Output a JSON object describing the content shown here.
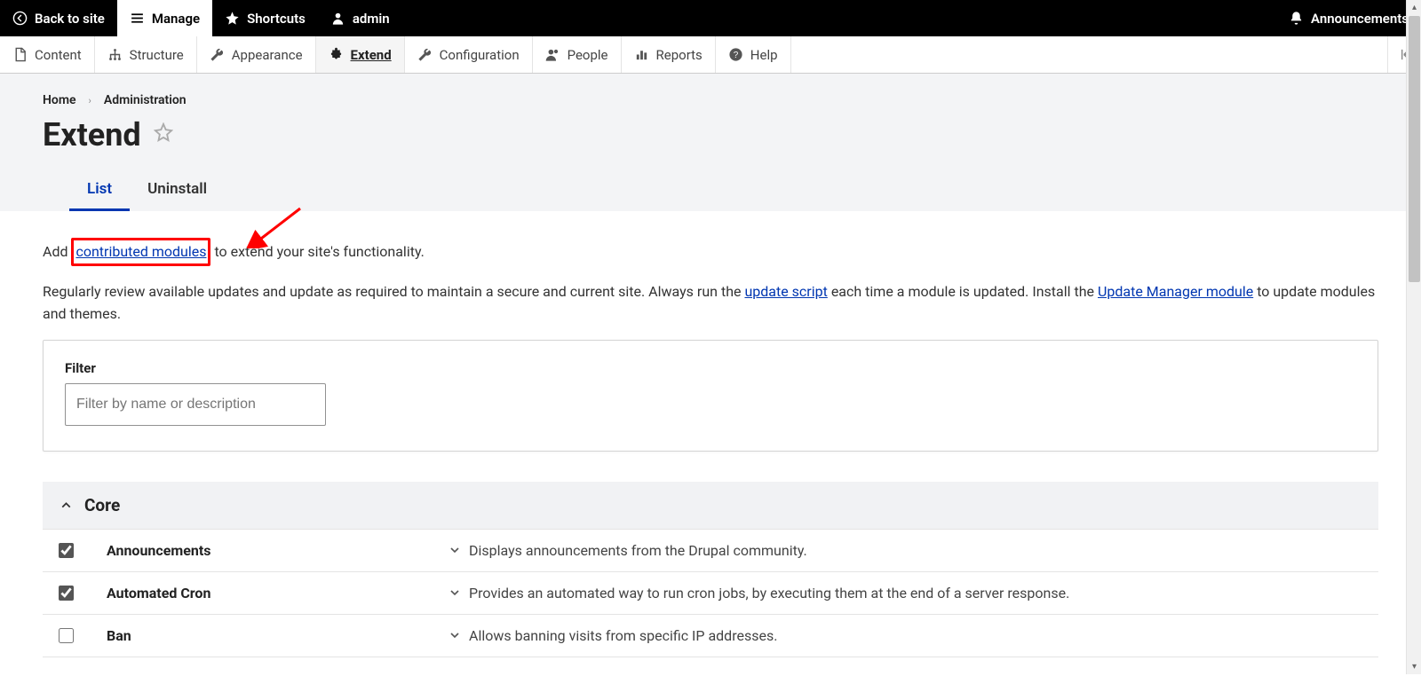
{
  "topbar": {
    "back": "Back to site",
    "manage": "Manage",
    "shortcuts": "Shortcuts",
    "admin": "admin",
    "announcements": "Announcements"
  },
  "secondbar": {
    "content": "Content",
    "structure": "Structure",
    "appearance": "Appearance",
    "extend": "Extend",
    "configuration": "Configuration",
    "people": "People",
    "reports": "Reports",
    "help": "Help"
  },
  "breadcrumb": {
    "home": "Home",
    "admin": "Administration"
  },
  "page_title": "Extend",
  "tabs": {
    "list": "List",
    "uninstall": "Uninstall"
  },
  "intro": {
    "add_prefix": "Add ",
    "contributed_modules": "contributed modules",
    "add_suffix": " to extend your site's functionality.",
    "line2_a": "Regularly review available updates and update as required to maintain a secure and current site. Always run the ",
    "update_script": "update script",
    "line2_b": " each time a module is updated. Install the ",
    "update_manager": "Update Manager module",
    "line2_c": " to update modules and themes."
  },
  "filter": {
    "label": "Filter",
    "placeholder": "Filter by name or description"
  },
  "group": {
    "core": "Core"
  },
  "modules": [
    {
      "name": "Announcements",
      "desc": "Displays announcements from the Drupal community.",
      "checked": true
    },
    {
      "name": "Automated Cron",
      "desc": "Provides an automated way to run cron jobs, by executing them at the end of a server response.",
      "checked": true
    },
    {
      "name": "Ban",
      "desc": "Allows banning visits from specific IP addresses.",
      "checked": false
    }
  ]
}
